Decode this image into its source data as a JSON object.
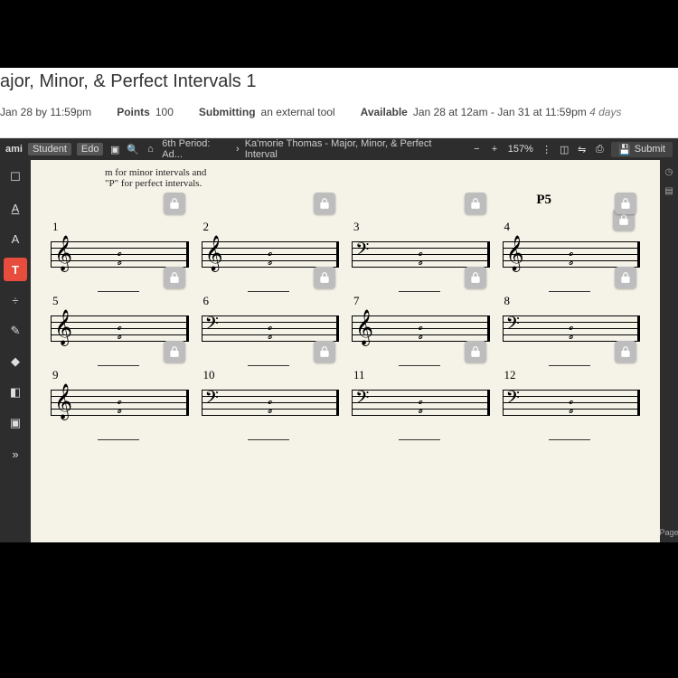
{
  "assignment": {
    "title": "ajor, Minor, & Perfect Intervals 1",
    "due_label": "Jan 28 by 11:59pm",
    "points_label": "Points",
    "points_value": "100",
    "submitting_label": "Submitting",
    "submitting_value": "an external tool",
    "available_label": "Available",
    "available_value": "Jan 28 at 12am - Jan 31 at 11:59pm",
    "available_suffix": "4 days"
  },
  "kami": {
    "brand": "ami",
    "role": "Student",
    "edit": "Edo",
    "crumb1": "6th Period: Ad...",
    "crumb2": "Ka'morie Thomas - Major, Minor, & Perfect Interval",
    "zoom": "157%",
    "submit": "Submit"
  },
  "tools": [
    "□",
    "A̲",
    "A",
    "T",
    "÷",
    "✎",
    "◆",
    "◧",
    "▣",
    "»"
  ],
  "worksheet": {
    "instruction_top": "m for minor intervals and",
    "instruction_bot": "\"P\" for perfect intervals.",
    "example": "P5",
    "cells": [
      {
        "n": "1",
        "clef": "treble"
      },
      {
        "n": "2",
        "clef": "treble"
      },
      {
        "n": "3",
        "clef": "bass"
      },
      {
        "n": "4",
        "clef": "treble"
      },
      {
        "n": "5",
        "clef": "treble"
      },
      {
        "n": "6",
        "clef": "bass"
      },
      {
        "n": "7",
        "clef": "treble"
      },
      {
        "n": "8",
        "clef": "bass"
      },
      {
        "n": "9",
        "clef": "treble"
      },
      {
        "n": "10",
        "clef": "bass"
      },
      {
        "n": "11",
        "clef": "bass"
      },
      {
        "n": "12",
        "clef": "bass"
      }
    ]
  }
}
